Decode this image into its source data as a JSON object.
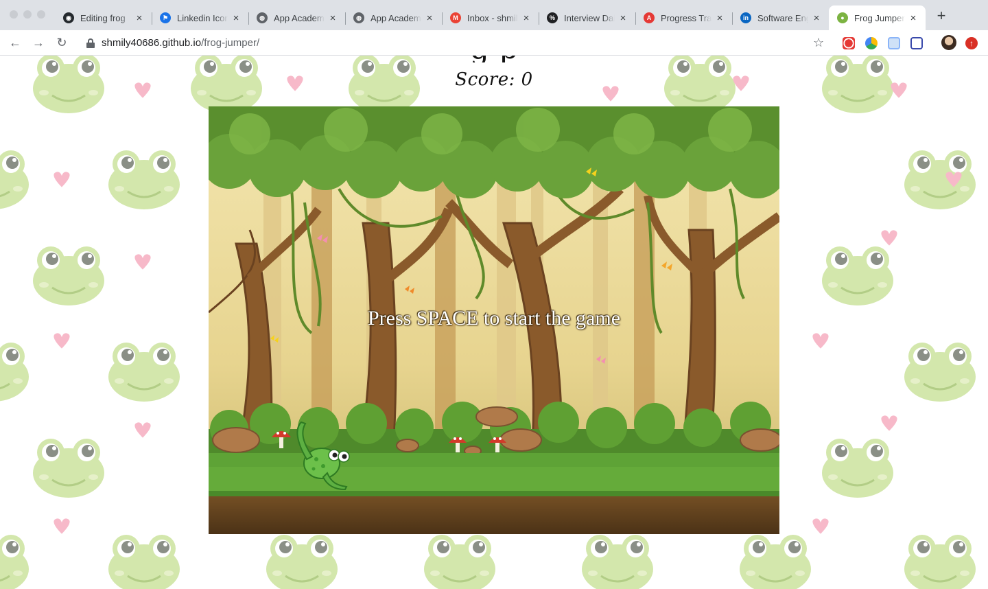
{
  "browser": {
    "tabs": [
      {
        "title": "Editing frog",
        "icon": "github-icon",
        "color": "#24292e"
      },
      {
        "title": "Linkedin Icon",
        "icon": "flag-icon",
        "color": "#1a73e8"
      },
      {
        "title": "App Academy",
        "icon": "globe-icon",
        "color": "#5f6368"
      },
      {
        "title": "App Academy",
        "icon": "globe-icon",
        "color": "#5f6368"
      },
      {
        "title": "Inbox - shmily",
        "icon": "gmail-icon",
        "color": "#ea4335"
      },
      {
        "title": "Interview Daily",
        "icon": "interview-icon",
        "color": "#202124"
      },
      {
        "title": "Progress Tracker",
        "icon": "a-icon",
        "color": "#e53935"
      },
      {
        "title": "Software Engineer",
        "icon": "linkedin-icon",
        "color": "#0a66c2"
      },
      {
        "title": "Frog Jumper",
        "icon": "frog-icon",
        "color": "#7cb342"
      }
    ],
    "active_tab_index": 8,
    "url_host": "shmily40686.github.io",
    "url_path": "/frog-jumper/"
  },
  "page": {
    "title_partial": "g    p",
    "score_label": "Score:",
    "score_value": "0",
    "start_message": "Press SPACE to start the game"
  },
  "colors": {
    "frog_pattern_green": "#cfe5a6",
    "heart_pink": "#f7b9c9",
    "canvas_sky": "#efe2a8",
    "foliage_green": "#4f8a2b",
    "ground_green": "#5aa035",
    "soil_brown": "#6b4a22"
  }
}
